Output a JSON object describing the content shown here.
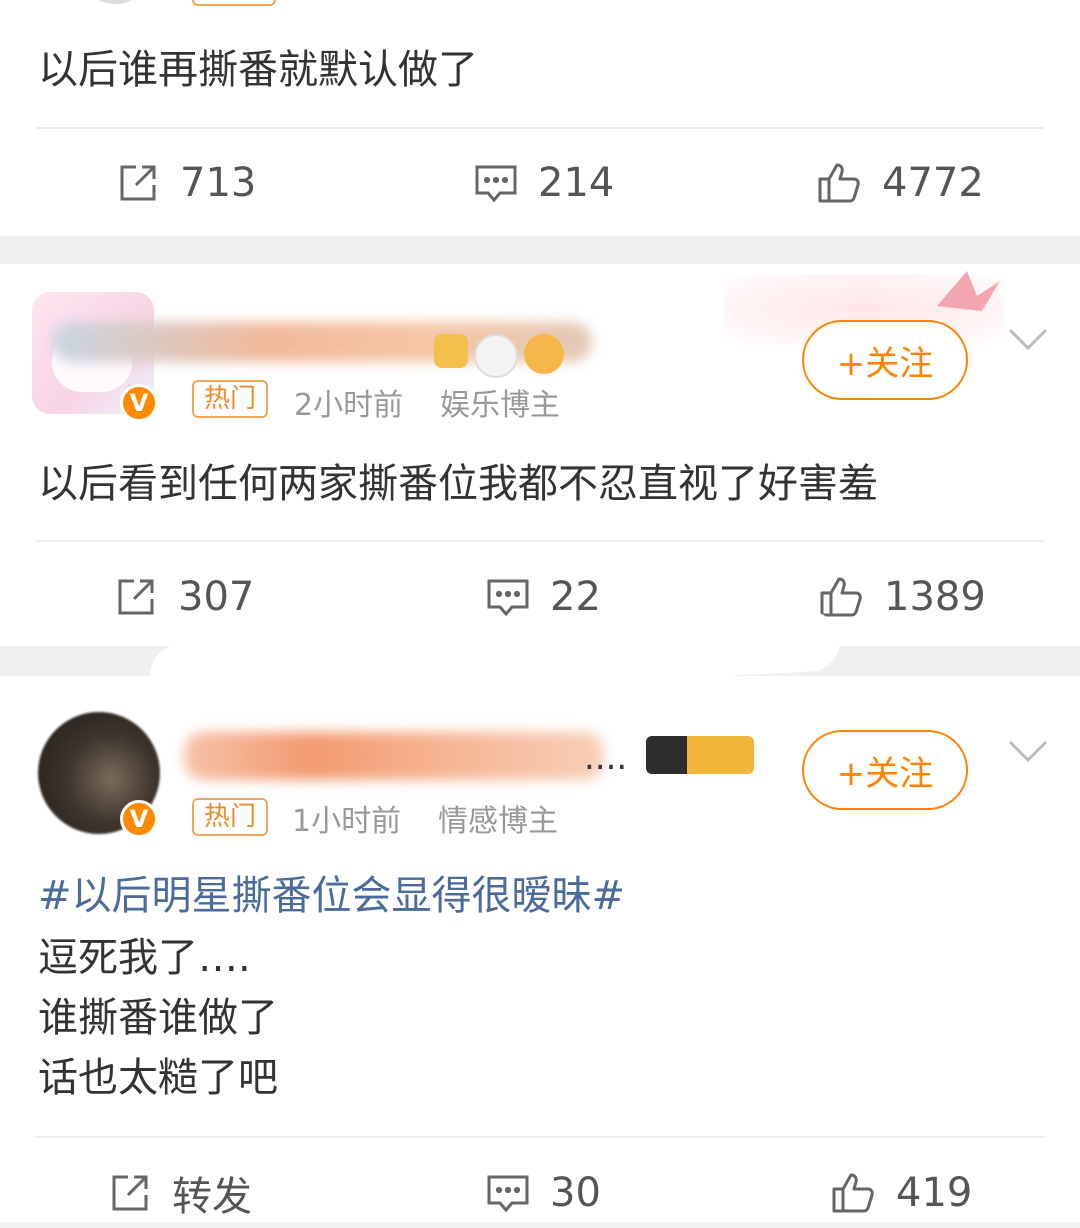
{
  "posts": [
    {
      "text": "以后谁再撕番就默认做了",
      "actions": {
        "repost": "713",
        "comment": "214",
        "like": "4772"
      }
    },
    {
      "hot_tag": "热门",
      "time": "2小时前",
      "category": "娱乐博主",
      "follow_label": "+关注",
      "text": "以后看到任何两家撕番位我都不忍直视了好害羞",
      "actions": {
        "repost": "307",
        "comment": "22",
        "like": "1389"
      }
    },
    {
      "hot_tag": "热门",
      "time": "1小时前",
      "category": "情感博主",
      "follow_label": "+关注",
      "name_suffix": "....",
      "hashtag": "#以后明星撕番位会显得很暧昧#",
      "lines": [
        "逗死我了….",
        "谁撕番谁做了",
        "话也太糙了吧"
      ],
      "actions": {
        "repost": "转发",
        "comment": "30",
        "like": "419"
      }
    }
  ],
  "colors": {
    "accent": "#ff8200",
    "hashtag": "#4a6b9c",
    "separator": "#f0f0f0"
  },
  "icons": {
    "repost": "share-square-icon",
    "comment": "comment-bubble-icon",
    "like": "thumbs-up-icon",
    "more": "chevron-down-icon",
    "verified": "v-badge-icon"
  }
}
